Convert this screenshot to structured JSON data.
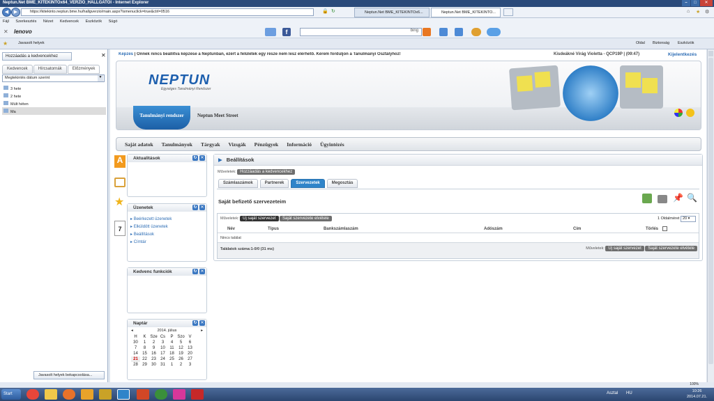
{
  "window": {
    "title": "Neptun.Net BME_KITEKINTOx64_VERZIO_HALLGATOI - Internet Explorer"
  },
  "browser": {
    "url": "https://kitekinto.neptun.bme.hu/hallgverzio/main.aspx?ismenuclick=true&ctrl=0516",
    "tabs": [
      "Neptun.Net BME_KITEKINTOx6...",
      "Neptun.Net BME_KITEKINTO..."
    ],
    "menu": [
      "Fájl",
      "Szerkesztés",
      "Nézet",
      "Kedvencek",
      "Eszközök",
      "Súgó"
    ],
    "lenovo": "lenovo",
    "bing": "bing",
    "favorites_link": "Javasolt helyek",
    "right_menu": [
      "Oldal",
      "Biztonság",
      "Eszközök"
    ],
    "zoom": "100%"
  },
  "sidepanel": {
    "add_button": "Hozzáadás a kedvencekhez",
    "tabs": [
      "Kedvencek",
      "Hírcsatornák",
      "Előzmények"
    ],
    "sort": "Megtekintés dátum szerint",
    "items": [
      "3 hete",
      "2 hete",
      "Múlt héten",
      "Ma"
    ],
    "bottom_button": "Javasolt helyek bekapcsolása..."
  },
  "header": {
    "warning_prefix": "Képzés",
    "warning": "Önnek nincs beállítva képzése a Neptunban, ezért a felületek egy része nem lesz elérhető. Kérem forduljon a Tanulmányi Osztályhoz!",
    "user": "Kisdeákné Virág Violetta - QCP19P",
    "time": "(09:47)",
    "logout": "Kijelentkezés",
    "logo": "NEPTUN",
    "logo_sub": "Egységes Tanulmányi Rendszer",
    "system_badge": "Tanulmányi rendszer",
    "meet_street": "Neptun Meet Street"
  },
  "mainmenu": [
    "Saját adatok",
    "Tanulmányok",
    "Tárgyak",
    "Vizsgák",
    "Pénzügyek",
    "Információ",
    "Ügyintézés"
  ],
  "leftcol": {
    "aktualitasok": "Aktualitások",
    "uzenetek": "Üzenetek",
    "msg_links": [
      "Beérkezett üzenetek",
      "Elküldött üzenetek",
      "Beállítások",
      "Címtár"
    ],
    "kedvenc": "Kedvenc funkciók",
    "naptar": "Naptár",
    "month": "2014. július",
    "weekdays": [
      "H",
      "K",
      "Sze",
      "Cs",
      "P",
      "Szo",
      "V"
    ],
    "weeks": [
      [
        "30",
        "1",
        "2",
        "3",
        "4",
        "5",
        "6"
      ],
      [
        "7",
        "8",
        "9",
        "10",
        "11",
        "12",
        "13"
      ],
      [
        "14",
        "15",
        "16",
        "17",
        "18",
        "19",
        "20"
      ],
      [
        "21",
        "22",
        "23",
        "24",
        "25",
        "26",
        "27"
      ],
      [
        "28",
        "29",
        "30",
        "31",
        "1",
        "2",
        "3"
      ]
    ]
  },
  "settings": {
    "title": "Beállítások",
    "muveletek": "Műveletek:",
    "fav_button": "Hozzáadás a kedvencekhez",
    "tabs": [
      "Számlaszámok",
      "Partnerek",
      "Szervezetek",
      "Megosztás"
    ],
    "section_title": "Saját befizető szervezeteim",
    "btn_new": "Új saját szervezet",
    "btn_remove": "Saját szervezete elvétele",
    "pager_label": "Oldalméret",
    "pager_value": "20",
    "pager_page": "1",
    "columns": [
      "Név",
      "Típus",
      "Bankszámlaszám",
      "Adószám",
      "Cím",
      "Törlés"
    ],
    "empty": "Nincs találat",
    "results": "Találatok száma:1-0/0 (31 ms)"
  },
  "taskbar": {
    "start": "Start",
    "lang": "HU",
    "asztal": "Asztal",
    "time": "10:26",
    "date": "2014.07.21."
  }
}
